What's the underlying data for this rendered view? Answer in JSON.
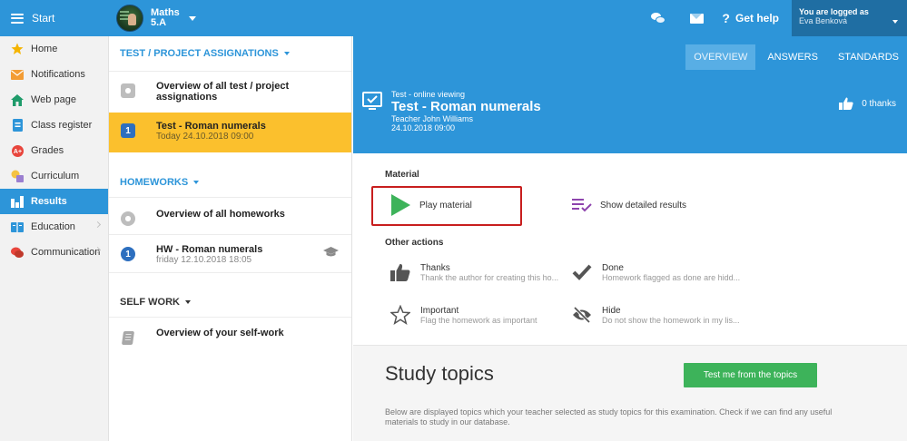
{
  "topbar": {
    "start_label": "Start",
    "class_name": "Maths",
    "class_group": "5.A",
    "help_label": "Get help",
    "help_q": "?",
    "logged_label": "You are logged as",
    "user_name": "Eva Benková"
  },
  "sidebar": {
    "items": [
      {
        "label": "Home",
        "icon": "star-icon"
      },
      {
        "label": "Notifications",
        "icon": "envelope-icon"
      },
      {
        "label": "Web page",
        "icon": "house-icon"
      },
      {
        "label": "Class register",
        "icon": "register-icon"
      },
      {
        "label": "Grades",
        "icon": "grades-icon"
      },
      {
        "label": "Curriculum",
        "icon": "curriculum-icon"
      },
      {
        "label": "Results",
        "icon": "results-icon"
      },
      {
        "label": "Education",
        "icon": "education-icon"
      },
      {
        "label": "Communication",
        "icon": "chat-icon"
      }
    ]
  },
  "middle": {
    "assign_header": "TEST / PROJECT ASSIGNATIONS",
    "assign_rows": [
      {
        "title": "Overview of all test / project assignations",
        "sub": ""
      },
      {
        "badge": "1",
        "title": "Test - Roman numerals",
        "sub": "Today 24.10.2018 09:00"
      }
    ],
    "homework_header": "HOMEWORKS",
    "homework_rows": [
      {
        "title": "Overview of all homeworks",
        "sub": ""
      },
      {
        "badge": "1",
        "title": "HW - Roman numerals",
        "sub": "friday 12.10.2018 18:05"
      }
    ],
    "self_header": "SELF WORK",
    "self_rows": [
      {
        "title": "Overview of your self-work"
      }
    ]
  },
  "right": {
    "tabs": [
      "OVERVIEW",
      "ANSWERS",
      "STANDARDS"
    ],
    "head_small": "Test - online viewing",
    "head_title": "Test - Roman numerals",
    "head_teacher": "Teacher John Williams",
    "head_date": "24.10.2018 09:00",
    "thanks_label": "0 thanks",
    "material_label": "Material",
    "play_label": "Play material",
    "detailed_label": "Show detailed results",
    "other_label": "Other actions",
    "actions": [
      {
        "title": "Thanks",
        "sub": "Thank the author for creating this ho..."
      },
      {
        "title": "Done",
        "sub": "Homework flagged as done are hidd..."
      },
      {
        "title": "Important",
        "sub": "Flag the homework as important"
      },
      {
        "title": "Hide",
        "sub": "Do not show the homework in my lis..."
      }
    ],
    "study_title": "Study topics",
    "study_button": "Test me from the topics",
    "study_desc": "Below are displayed topics which your teacher selected as study topics for this examination. Check if we can find any useful materials to study in our database."
  },
  "colors": {
    "brand_blue": "#2d95d9",
    "selected_yellow": "#fbc02d",
    "green_button": "#3db35a",
    "highlight_red": "#c81e1e"
  }
}
